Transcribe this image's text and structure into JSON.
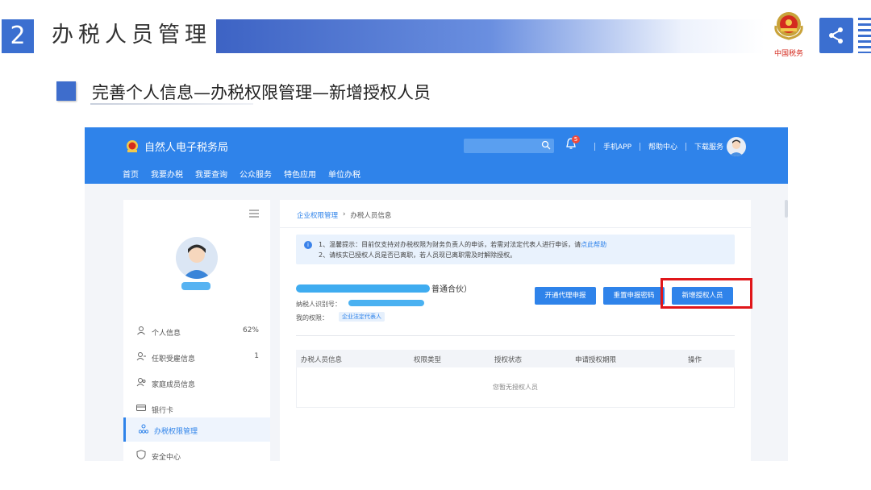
{
  "slide": {
    "section_number": "2",
    "section_title": "办税人员管理",
    "emblem_text": "中国税务",
    "subtitle": "完善个人信息—办税权限管理—新增授权人员"
  },
  "app": {
    "brand": "自然人电子税务局",
    "search_placeholder": "",
    "notification_count": "5",
    "top_links": [
      "手机APP",
      "帮助中心",
      "下载服务"
    ],
    "menu": [
      "首页",
      "我要办税",
      "我要查询",
      "公众服务",
      "特色应用",
      "单位办税"
    ]
  },
  "sidebar": {
    "items": [
      {
        "label": "个人信息",
        "value": "62%",
        "icon": "person-icon"
      },
      {
        "label": "任职受雇信息",
        "value": "1",
        "icon": "person-badge-icon"
      },
      {
        "label": "家庭成员信息",
        "value": "",
        "icon": "family-icon"
      },
      {
        "label": "银行卡",
        "value": "",
        "icon": "bank-card-icon"
      },
      {
        "label": "办税权限管理",
        "value": "",
        "icon": "org-chart-icon"
      },
      {
        "label": "安全中心",
        "value": "",
        "icon": "shield-icon"
      }
    ],
    "active_index": 4
  },
  "content": {
    "breadcrumb": {
      "parent": "企业权限管理",
      "current": "办税人员信息"
    },
    "notice": {
      "line1": "1、温馨提示：目前仅支持对办税权限为财务负责人的申诉，若需对法定代表人进行申诉，请",
      "line1_link": "点此帮助",
      "line2": "2、请核实已授权人员是否已离职，若人员现已离职需及时解除授权。"
    },
    "org_suffix": "普通合伙）",
    "tin_label": "纳税人识别号：",
    "perm_label": "我的权限：",
    "perm_tag": "企业法定代表人",
    "buttons": {
      "open_agent": "开通代理申报",
      "reset_pwd": "重置申报密码",
      "add_auth": "新增授权人员"
    },
    "table": {
      "headers": [
        "办税人员信息",
        "权限类型",
        "授权状态",
        "申请授权期限",
        "操作"
      ],
      "empty_text": "您暂无授权人员"
    }
  },
  "colors": {
    "primary": "#2f83ea",
    "slide_blue": "#3b6fd0",
    "highlight": "#e0161a"
  }
}
